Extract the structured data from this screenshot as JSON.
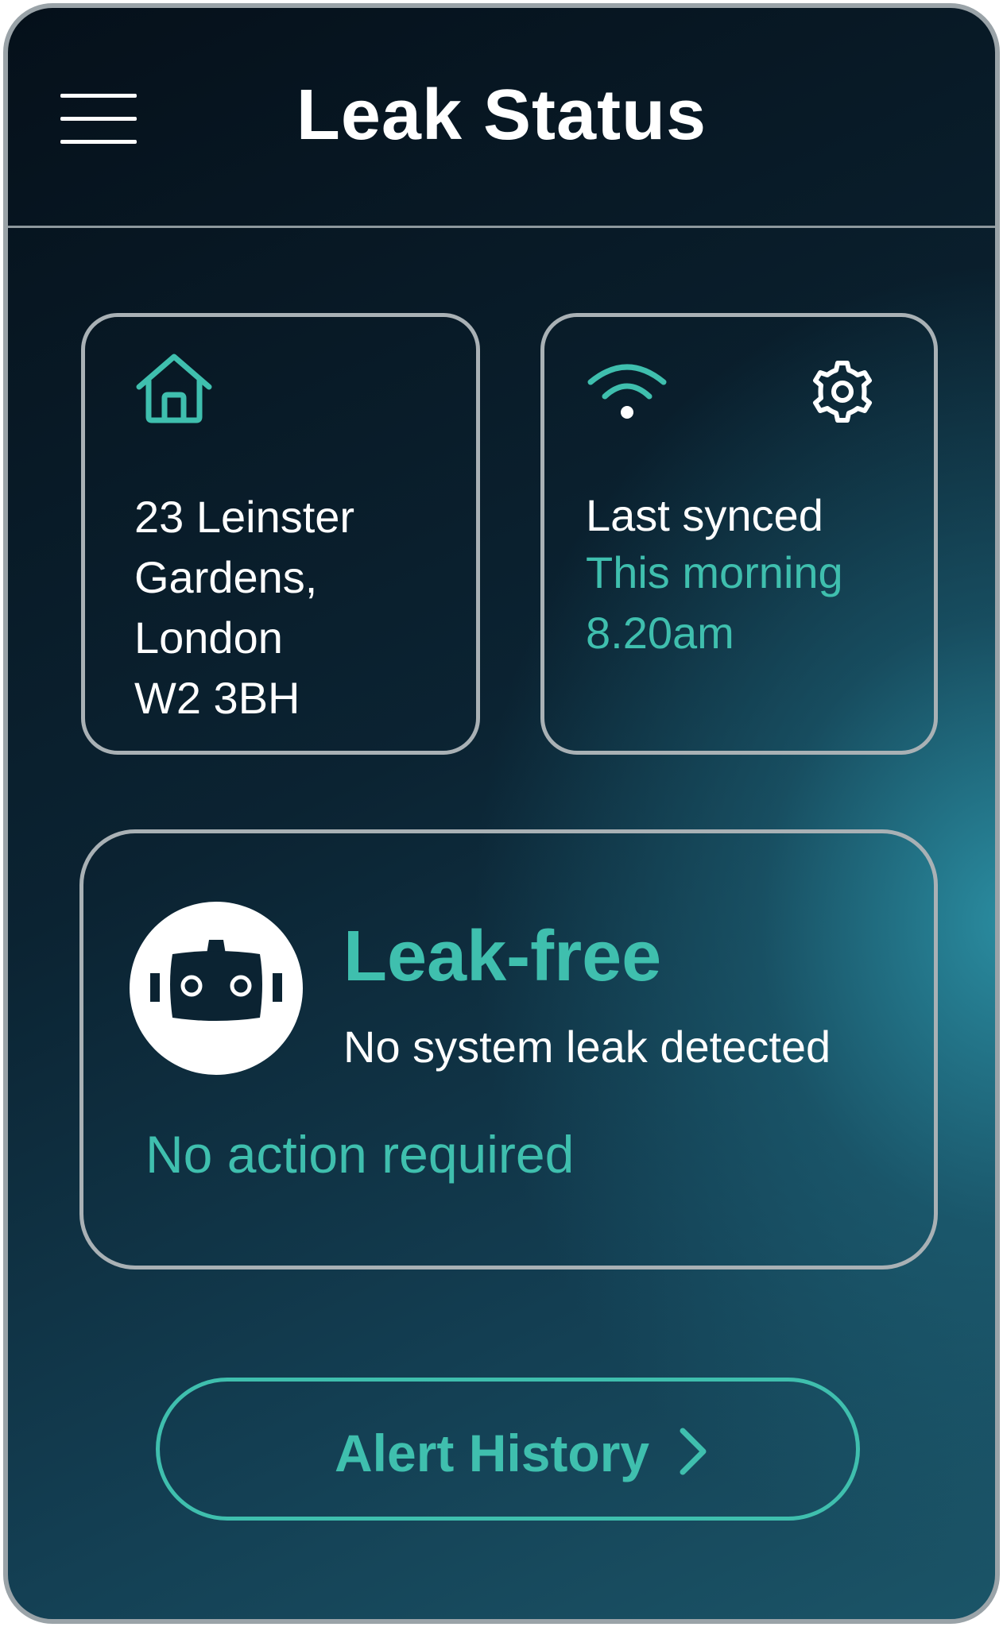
{
  "header": {
    "title": "Leak Status",
    "menu_icon": "hamburger-menu-icon"
  },
  "address_card": {
    "icon": "home-icon",
    "lines": [
      "23 Leinster",
      "Gardens,",
      "London",
      "W2 3BH"
    ]
  },
  "sync_card": {
    "wifi_icon": "wifi-icon",
    "settings_icon": "gear-icon",
    "label": "Last synced",
    "value_lines": [
      "This morning",
      "8.20am"
    ]
  },
  "status_card": {
    "icon": "robot-icon",
    "title": "Leak-free",
    "subtitle": "No system leak detected",
    "action": "No action required"
  },
  "history_button": {
    "label": "Alert History",
    "icon": "chevron-right-icon"
  },
  "colors": {
    "accent": "#3fbfae",
    "text": "#ffffff",
    "border": "#a9b1b5",
    "background_dark": "#05101a",
    "background_teal": "#2a8ca0"
  }
}
